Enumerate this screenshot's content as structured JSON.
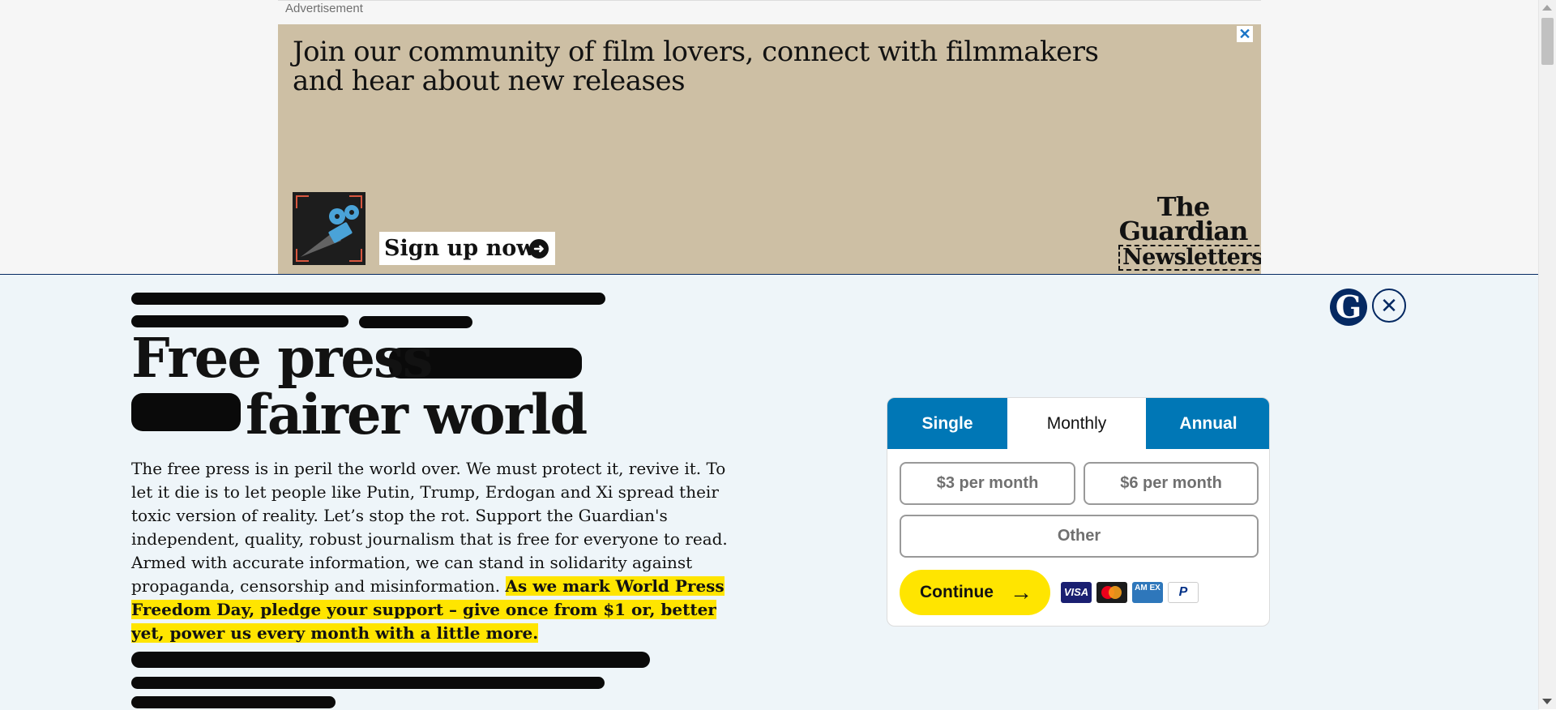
{
  "ad": {
    "label": "Advertisement",
    "headline": "Join our community of film lovers, connect with filmmakers and hear about new releases",
    "close_glyph": "✕",
    "cta": "Sign up now",
    "brand_line1": "The",
    "brand_line2": "Guardian",
    "brand_line3": "Newsletters"
  },
  "epic": {
    "headline_line1": "Free press",
    "headline_line2": "fairer world",
    "body": "The free press is in peril the world over. We must protect it, revive it. To let it die is to let people like Putin, Trump, Erdogan and Xi spread their toxic version of reality. Let’s stop the rot. Support the Guardian's independent, quality, robust journalism that is free for everyone to read. Armed with accurate information, we can stand in solidarity against propaganda, censorship and misinformation. ",
    "body_highlight": "As we mark World Press Freedom Day, pledge your support – give once from $1 or, better yet, power us every month with a little more.",
    "logo_glyph": "G",
    "close_glyph": "✕"
  },
  "contribution": {
    "tabs": [
      "Single",
      "Monthly",
      "Annual"
    ],
    "selected_tab": "Monthly",
    "amounts": [
      "$3 per month",
      "$6 per month",
      "Other"
    ],
    "continue_label": "Continue",
    "continue_arrow": "→",
    "payment_methods": [
      "VISA",
      "Mastercard",
      "AMEX",
      "PayPal"
    ],
    "amex_text": "AM EX",
    "paypal_text": "P"
  },
  "colors": {
    "brand_blue": "#052962",
    "tab_blue": "#0077b6",
    "highlight_yellow": "#ffe500",
    "banner_bg": "#eef5f9",
    "ad_bg": "#cdbfa4"
  }
}
